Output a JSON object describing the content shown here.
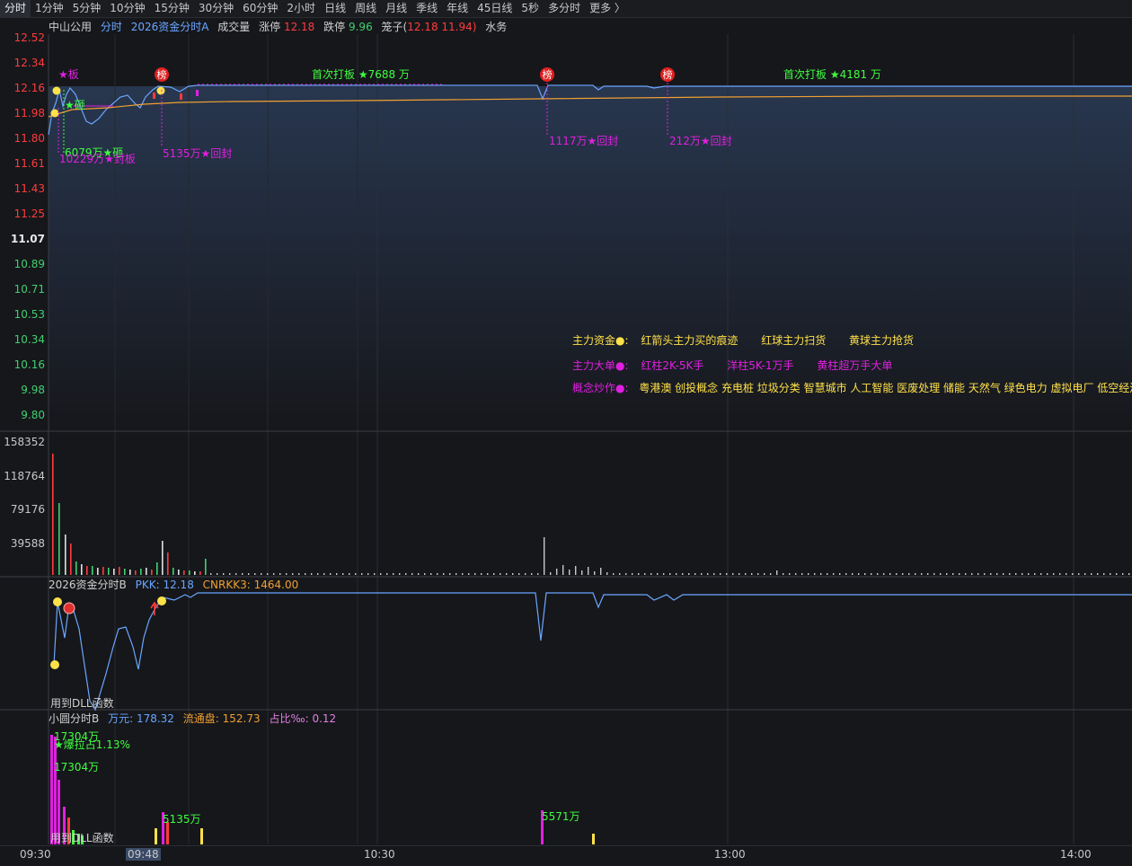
{
  "toolbar": {
    "timeframes": [
      "分时",
      "1分钟",
      "5分钟",
      "10分钟",
      "15分钟",
      "30分钟",
      "60分钟",
      "2小时",
      "日线",
      "周线",
      "月线",
      "季线",
      "年线",
      "45日线",
      "5秒",
      "多分时",
      "更多 〉"
    ],
    "active_index": 0
  },
  "header": {
    "stock_name": "中山公用",
    "tab_label": "分时",
    "indicator_name": "2026资金分时A",
    "volume_label": "成交量",
    "limit_up_label": "涨停",
    "limit_up_value": "12.18",
    "limit_down_label": "跌停",
    "limit_down_value": "9.96",
    "cage_label": "笼子(",
    "cage_values": "12.18 11.94)",
    "water_label": "水务"
  },
  "price_axis": {
    "labels": [
      "12.52",
      "12.34",
      "12.16",
      "11.98",
      "11.80",
      "11.61",
      "11.43",
      "11.25",
      "11.07",
      "10.89",
      "10.71",
      "10.53",
      "10.34",
      "10.16",
      "9.98",
      "9.80"
    ],
    "prev_close": "11.07"
  },
  "volume_axis": {
    "labels": [
      "158352",
      "118764",
      "79176",
      "39588"
    ]
  },
  "annotations": {
    "board_star": "★板",
    "smash_star": "★砸",
    "smash_amount": "6079万★砸",
    "seal_amount": "10229万★封板",
    "reseal1": "5135万★回封",
    "first_board1": "首次打板 ★7688 万",
    "reseal2": "1117万★回封",
    "reseal3": "212万★回封",
    "first_board2": "首次打板 ★4181 万",
    "bang_label": "榜"
  },
  "legend": {
    "row1_title": "主力资金●:",
    "row1_items": [
      "红箭头主力买的痕迹",
      "红球主力扫货",
      "黄球主力抢货"
    ],
    "row2_title": "主力大单●:",
    "row2_items": [
      "红柱2K-5K手",
      "洋柱5K-1万手",
      "黄柱超万手大单"
    ],
    "row3_title": "概念炒作●:",
    "row3_text": "粤港澳 创投概念 充电桩 垃圾分类 智慧城市 人工智能 医废处理 储能 天然气 绿色电力 虚拟电厂 低空经济"
  },
  "panel2": {
    "name": "2026资金分时B",
    "pkk_label": "PKK:",
    "pkk_value": "12.18",
    "cnrkk_label": "CNRKK3:",
    "cnrkk_value": "1464.00",
    "dll_note": "用到DLL函数"
  },
  "panel3": {
    "name": "小圆分时B",
    "wan_label": "万元:",
    "wan_value": "178.32",
    "float_label": "流通盘:",
    "float_value": "152.73",
    "ratio_label": "占比‰:",
    "ratio_value": "0.12",
    "pull_label": "17304万",
    "pull_ratio": "★爆拉占1.13%",
    "amount2": "17304万",
    "amount3": "5135万",
    "amount4": "5571万",
    "dll_note": "用到DLL函数"
  },
  "time_axis": {
    "labels": [
      "09:30",
      "09:48",
      "10:30",
      "13:00",
      "14:00"
    ],
    "cursor_label": "09:48"
  },
  "colors": {
    "up": "#ff3c3c",
    "down": "#00c060",
    "price_line": "#6aa6ff",
    "avg_line": "#f0a030",
    "magenta": "#e020e0",
    "yellow": "#ffe14a",
    "green": "#40ff40"
  }
}
